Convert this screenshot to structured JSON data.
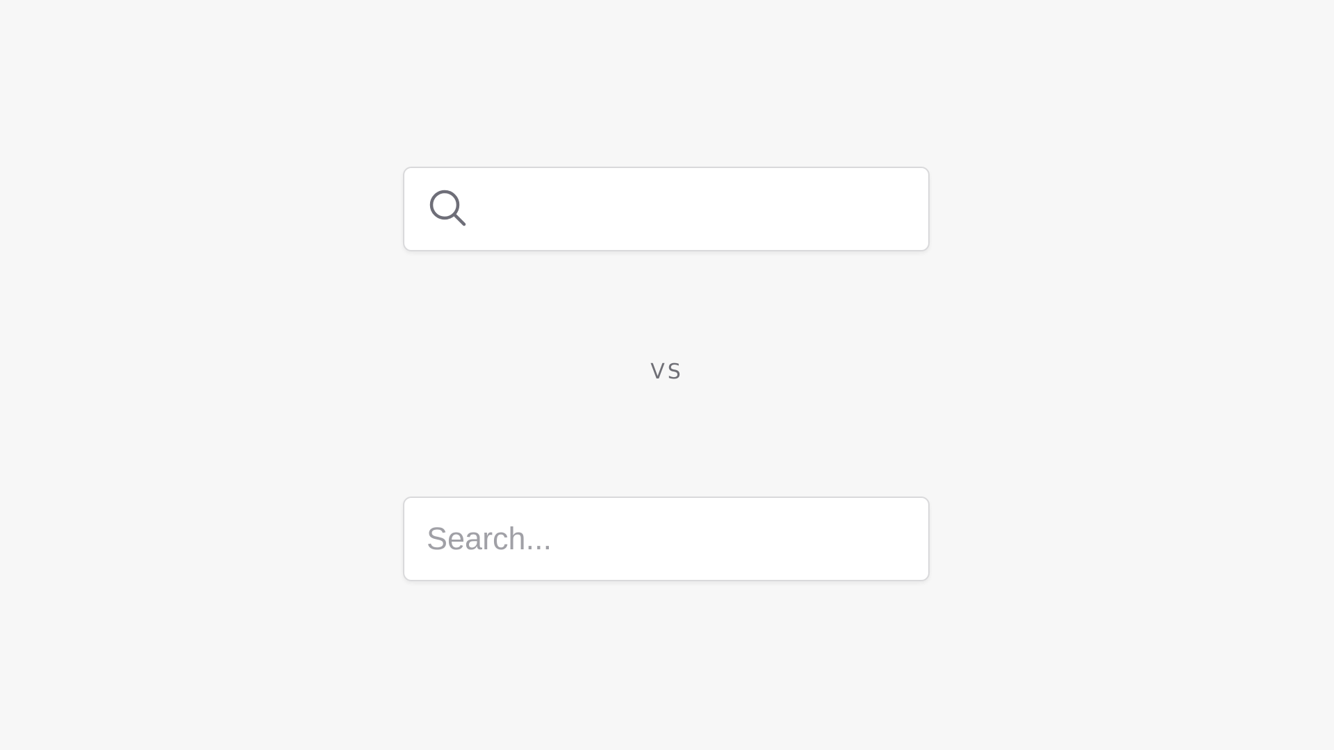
{
  "colors": {
    "background": "#f7f7f7",
    "box_background": "#ffffff",
    "box_border": "#d9d9db",
    "icon": "#6e6e78",
    "placeholder": "#a0a0a6",
    "separator_text": "#6f6f76"
  },
  "icon_search": {
    "icon": "search-icon",
    "value": "",
    "placeholder": ""
  },
  "separator": {
    "label": "VS"
  },
  "text_search": {
    "value": "",
    "placeholder": "Search..."
  }
}
